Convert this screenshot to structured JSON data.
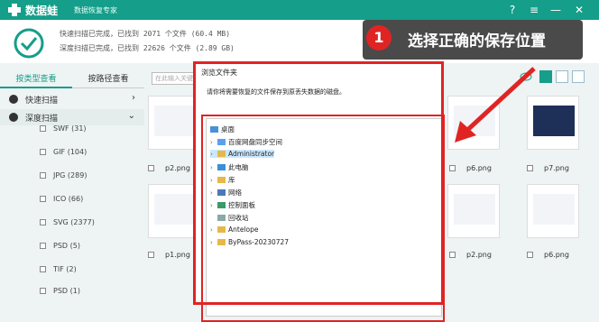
{
  "app": {
    "name": "数据蛙",
    "subtitle": "数据恢复专家"
  },
  "window_controls": [
    "?",
    "≡",
    "—",
    "✕"
  ],
  "status": {
    "line1": "快速扫描已完成，已找到 2071 个文件 (60.4 MB)",
    "line2": "深度扫描已完成，已找到 22626 个文件 (2.89 GB)"
  },
  "tabs": {
    "by_type": "按类型查看",
    "by_path": "按路径查看"
  },
  "sidebar": {
    "quick_scan": "快速扫描",
    "deep_scan": "深度扫描",
    "items": [
      "SWF (31)",
      "GIF (104)",
      "JPG (289)",
      "ICO (66)",
      "SVG (2377)",
      "PSD (5)",
      "TIF (2)",
      "PSD (1)"
    ]
  },
  "search": {
    "placeholder": "在此输入关键..."
  },
  "thumbs": {
    "row1": [
      "p2.png",
      "p6.png",
      "p7.png"
    ],
    "row2": [
      "p1.png",
      "p2.png",
      "p6.png"
    ]
  },
  "dialog": {
    "title": "浏览文件夹",
    "desc": "请你将需要恢复的文件保存到原丢失数据的磁盘。",
    "tree": [
      "桌面",
      "百度网盘同步空间",
      "Administrator",
      "此电脑",
      "库",
      "网络",
      "控制面板",
      "回收站",
      "Antelope",
      "ByPass-20230727"
    ]
  },
  "callout": {
    "badge": "1",
    "text": "选择正确的保存位置"
  },
  "colors": {
    "brand": "#159e8a",
    "highlight": "#e02424"
  }
}
